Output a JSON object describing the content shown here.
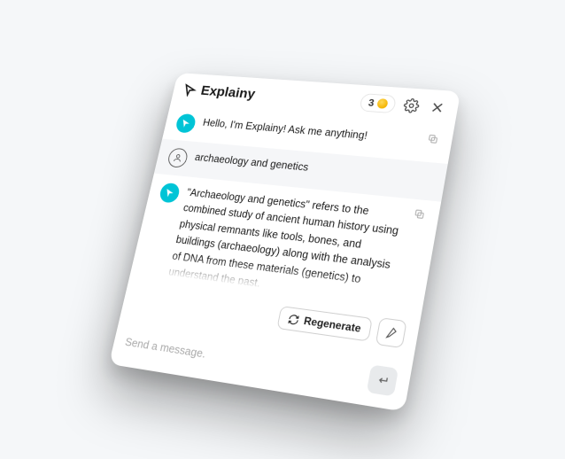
{
  "header": {
    "brand": "Explainy",
    "coin_count": "3"
  },
  "messages": {
    "greeting": "Hello, I'm Explainy! Ask me anything!",
    "user_query": "archaeology and genetics",
    "bot_reply": "\"Archaeology and genetics\" refers to the combined study of ancient human history using physical remnants like tools, bones, and buildings (archaeology) along with the analysis of DNA from these materials (genetics) to understand the past."
  },
  "actions": {
    "regenerate_label": "Regenerate"
  },
  "composer": {
    "placeholder": "Send a message."
  }
}
